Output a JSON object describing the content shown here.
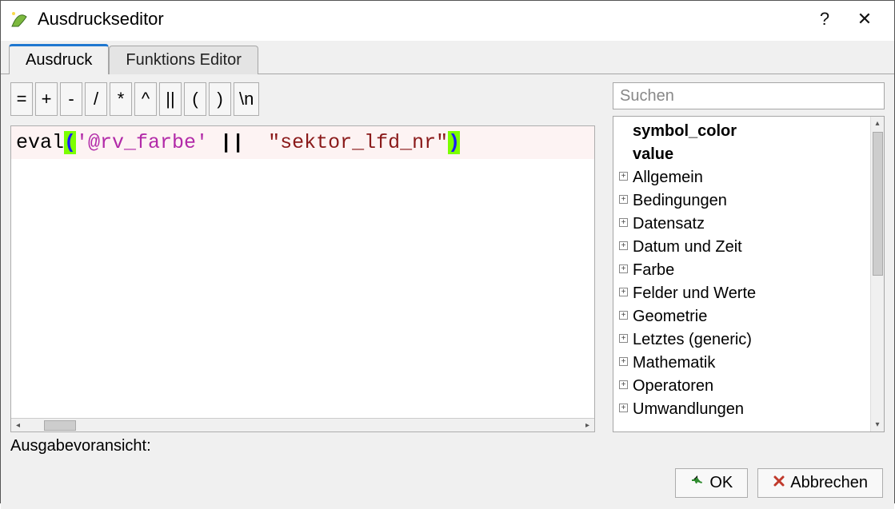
{
  "titlebar": {
    "title": "Ausdruckseditor",
    "help_tooltip": "?",
    "close_tooltip": "✕"
  },
  "tabs": {
    "expression": "Ausdruck",
    "function_editor": "Funktions Editor"
  },
  "operators": [
    "=",
    "+",
    "-",
    "/",
    "*",
    "^",
    "||",
    "(",
    ")",
    "\\n"
  ],
  "expression": {
    "func": "eval",
    "paren_open": "(",
    "string_lit": "'@rv_farbe'",
    "concat_op": "||",
    "field_lit": "\"sektor_lfd_nr\"",
    "paren_close": ")"
  },
  "search": {
    "placeholder": "Suchen"
  },
  "tree": {
    "items": [
      {
        "label": "symbol_color",
        "bold": true,
        "expandable": false
      },
      {
        "label": "value",
        "bold": true,
        "expandable": false
      },
      {
        "label": "Allgemein",
        "bold": false,
        "expandable": true
      },
      {
        "label": "Bedingungen",
        "bold": false,
        "expandable": true
      },
      {
        "label": "Datensatz",
        "bold": false,
        "expandable": true
      },
      {
        "label": "Datum und Zeit",
        "bold": false,
        "expandable": true
      },
      {
        "label": "Farbe",
        "bold": false,
        "expandable": true
      },
      {
        "label": "Felder und Werte",
        "bold": false,
        "expandable": true
      },
      {
        "label": "Geometrie",
        "bold": false,
        "expandable": true
      },
      {
        "label": "Letztes (generic)",
        "bold": false,
        "expandable": true
      },
      {
        "label": "Mathematik",
        "bold": false,
        "expandable": true
      },
      {
        "label": "Operatoren",
        "bold": false,
        "expandable": true
      },
      {
        "label": "Umwandlungen",
        "bold": false,
        "expandable": true
      }
    ]
  },
  "preview": {
    "label": "Ausgabevoransicht:"
  },
  "buttons": {
    "ok": "OK",
    "cancel": "Abbrechen"
  }
}
